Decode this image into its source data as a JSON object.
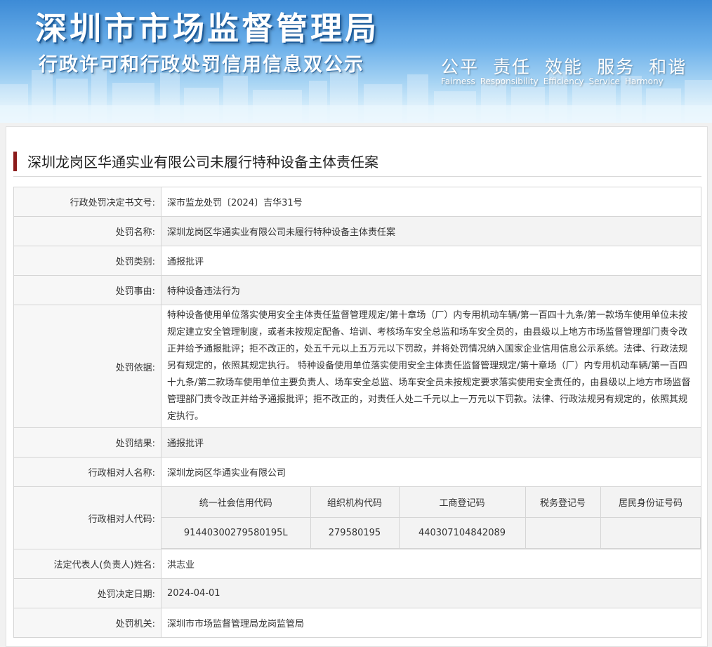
{
  "banner": {
    "title": "深圳市市场监督管理局",
    "subtitle": "行政许可和行政处罚信用信息双公示",
    "slogans_cn": [
      "公平",
      "责任",
      "效能",
      "服务",
      "和谐"
    ],
    "slogans_en": [
      "Fairness",
      "Responsibility",
      "Efficiency",
      "Service",
      "Harmony"
    ]
  },
  "case": {
    "title": "深圳龙岗区华通实业有限公司未履行特种设备主体责任案"
  },
  "fields": {
    "decision_no": {
      "label": "行政处罚决定书文号:",
      "value": "深市监龙处罚〔2024〕吉华31号"
    },
    "penalty_name": {
      "label": "处罚名称:",
      "value": "深圳龙岗区华通实业有限公司未履行特种设备主体责任案"
    },
    "penalty_type": {
      "label": "处罚类别:",
      "value": "通报批评"
    },
    "penalty_reason": {
      "label": "处罚事由:",
      "value": "特种设备违法行为"
    },
    "penalty_basis": {
      "label": "处罚依据:",
      "value": "特种设备使用单位落实使用安全主体责任监督管理规定/第十章场（厂）内专用机动车辆/第一百四十九条/第一款场车使用单位未按规定建立安全管理制度，或者未按规定配备、培训、考核场车安全总监和场车安全员的，由县级以上地方市场监督管理部门责令改正并给予通报批评；拒不改正的，处五千元以上五万元以下罚款，并将处罚情况纳入国家企业信用信息公示系统。法律、行政法规另有规定的，依照其规定执行。 特种设备使用单位落实使用安全主体责任监督管理规定/第十章场（厂）内专用机动车辆/第一百四十九条/第二款场车使用单位主要负责人、场车安全总监、场车安全员未按规定要求落实使用安全责任的，由县级以上地方市场监督管理部门责令改正并给予通报批评；拒不改正的，对责任人处二千元以上一万元以下罚款。法律、行政法规另有规定的，依照其规定执行。"
    },
    "penalty_result": {
      "label": "处罚结果:",
      "value": "通报批评"
    },
    "party_name": {
      "label": "行政相对人名称:",
      "value": "深圳龙岗区华通实业有限公司"
    },
    "party_codes": {
      "label": "行政相对人代码:",
      "headers": [
        "统一社会信用代码",
        "组织机构代码",
        "工商登记码",
        "税务登记号",
        "居民身份证号码"
      ],
      "values": [
        "91440300279580195L",
        "279580195",
        "440307104842089",
        "",
        ""
      ]
    },
    "legal_rep": {
      "label": "法定代表人(负责人)姓名:",
      "value": "洪志业"
    },
    "decision_date": {
      "label": "处罚决定日期:",
      "value": "2024-04-01"
    },
    "authority": {
      "label": "处罚机关:",
      "value": "深圳市市场监督管理局龙岗监管局"
    }
  }
}
